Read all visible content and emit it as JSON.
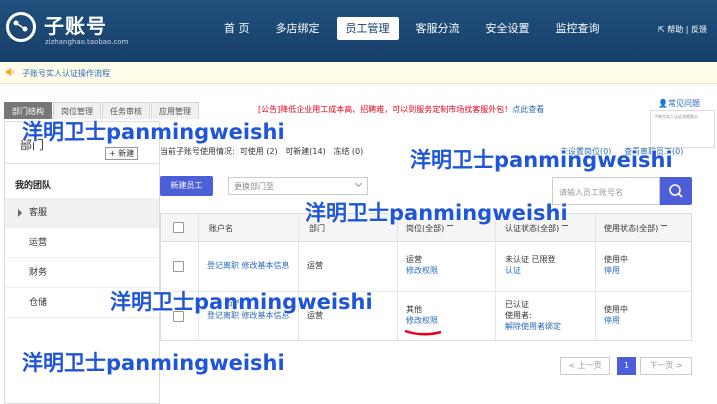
{
  "brand": {
    "name": "子账号",
    "sub": "zizhanghao.taobao.com"
  },
  "nav": [
    "首 页",
    "多店绑定",
    "员工管理",
    "客服分流",
    "安全设置",
    "监控查询"
  ],
  "nav_active_index": 2,
  "top_links": "帮助 | 反馈",
  "notice": "子账号实人认证操作流程",
  "tabs": [
    "部门结构",
    "岗位管理",
    "任务审核",
    "应用管理"
  ],
  "promo": {
    "tag": "[公告]",
    "text": "降低企业用工成本高、招聘难，可以到服务定制市场找客服外包！",
    "link": "点此查看"
  },
  "faq": "常见问题",
  "thumb_text": "子账号实人认证流程图示",
  "sidebar": {
    "title": "部门",
    "new_btn": "+ 新建",
    "team": "我的团队",
    "depts": [
      "客服",
      "运营",
      "财务",
      "仓储"
    ]
  },
  "usage": {
    "text": "当前子账号使用情况:",
    "avail": "可使用 (2)",
    "newable": "可新建(14)",
    "frozen": "冻结 (0)",
    "unset": "未设置岗位(0)",
    "view": "查看离职员工(0)"
  },
  "toolbar": {
    "new_staff": "新建员工",
    "move_placeholder": "更换部门至",
    "search_placeholder": "请输入员工账号名"
  },
  "table": {
    "headers": [
      "账户名",
      "部门",
      "岗位(全部)",
      "认证状态(全部)",
      "使用状态(全部)"
    ],
    "rows": [
      {
        "name": "",
        "actions": "登记离职 修改基本信息",
        "dept": "运营",
        "post": "运营",
        "post_link": "修改权限",
        "auth": "未认证 已限登",
        "auth_link": "认证",
        "status": "使用中",
        "status_link": "停用"
      },
      {
        "name": "知产",
        "actions": "登记离职 修改基本信息",
        "dept": "运营",
        "post": "其他",
        "post_link": "修改权限",
        "auth": "已认证",
        "auth_user": "使用者:",
        "auth_link": "解除使用者绑定",
        "status": "使用中",
        "status_link": "停用"
      }
    ]
  },
  "pager": {
    "prev": "< 上一页",
    "page": "1",
    "next": "下一页 >"
  },
  "watermark": "洋明卫士panmingweishi",
  "colors": {
    "topbar": "#173f69",
    "accent": "#4d5fd8",
    "link": "#2b6ab8",
    "watermark": "#1f55d8"
  }
}
